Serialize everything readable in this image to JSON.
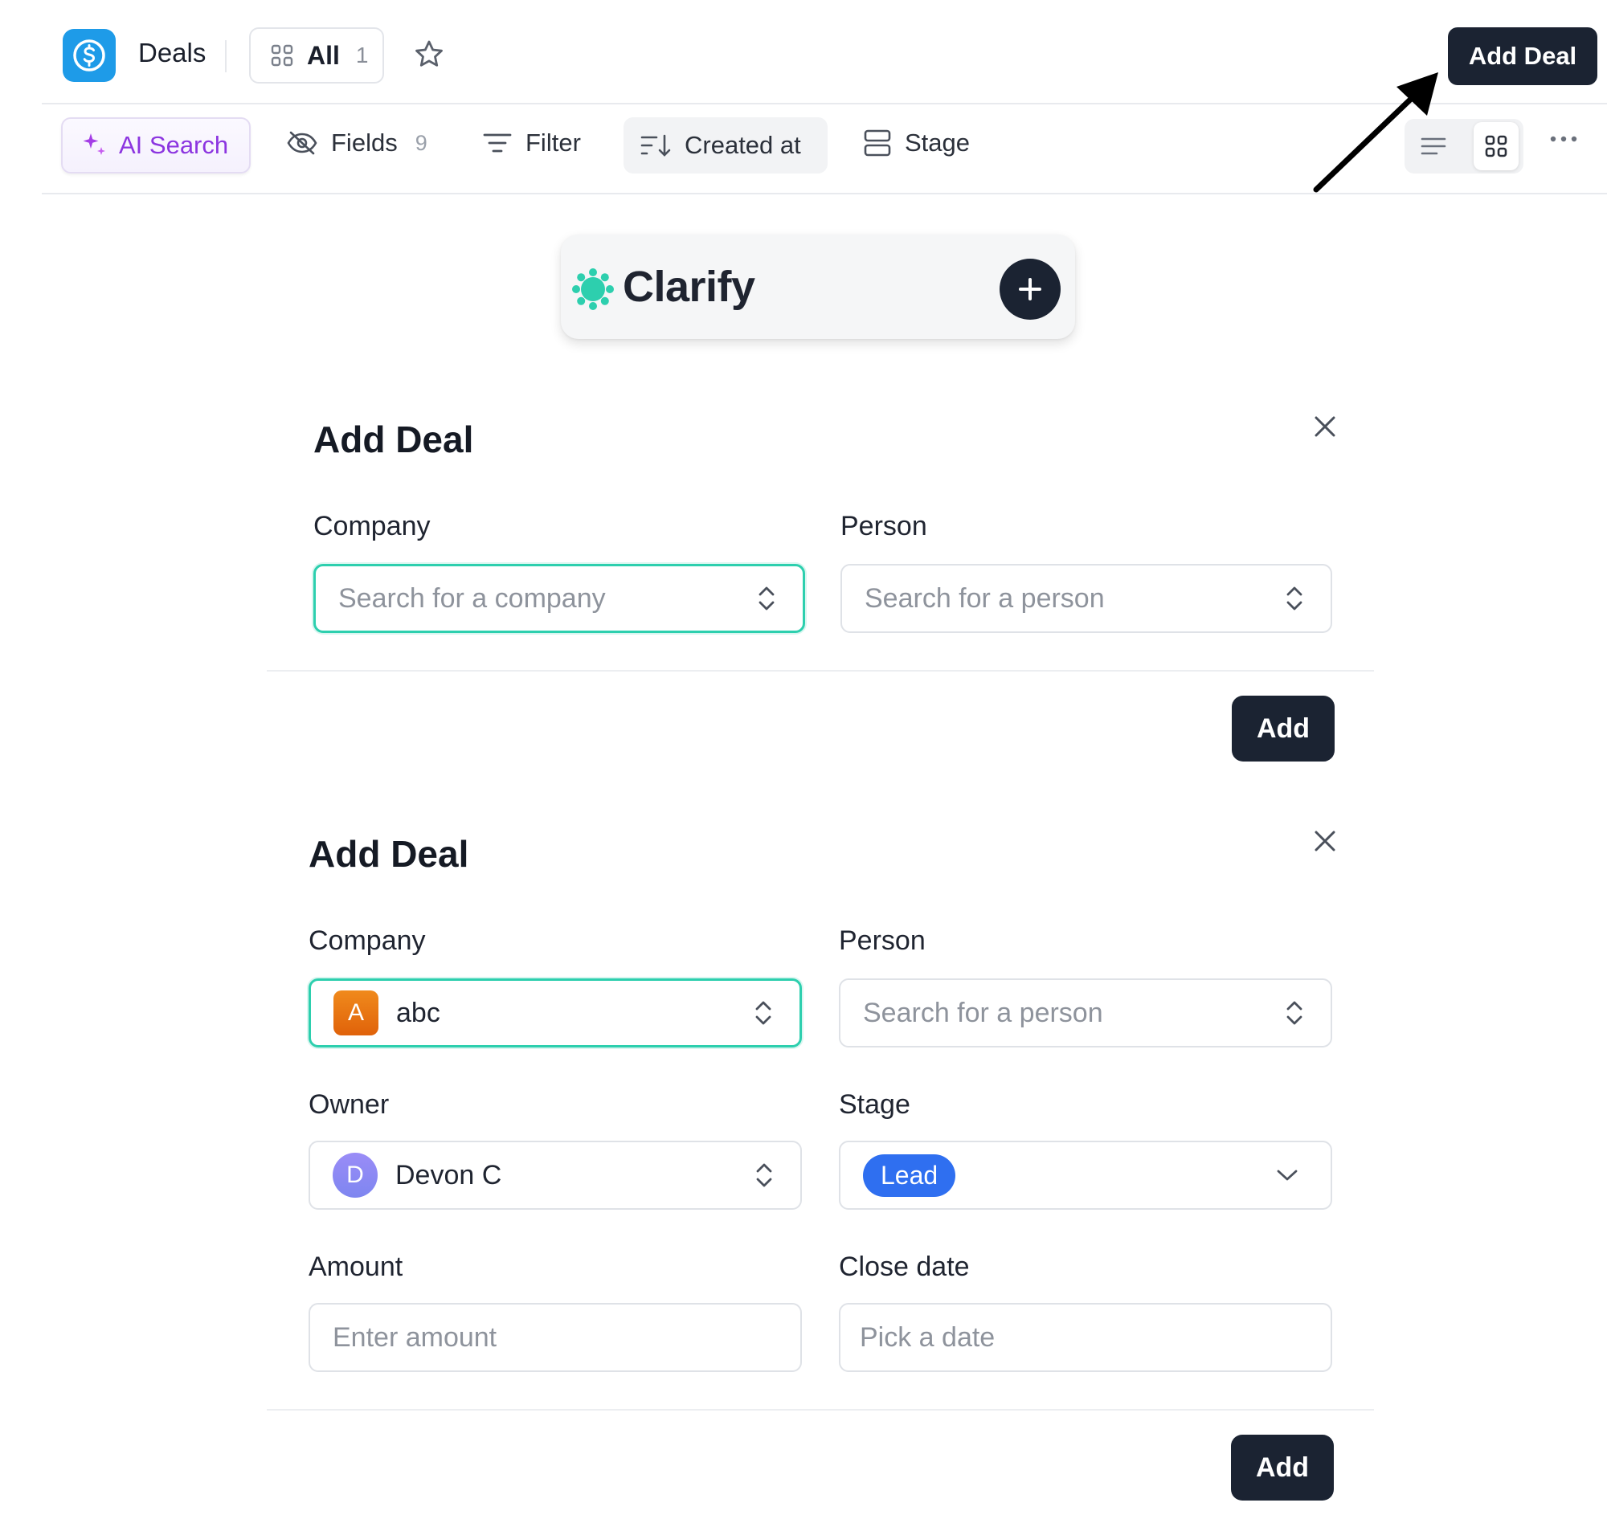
{
  "header": {
    "title": "Deals",
    "view_label": "All",
    "view_count": "1",
    "add_deal_label": "Add Deal",
    "brand_color": "#1e9be8"
  },
  "toolbar": {
    "ai_search_label": "AI Search",
    "fields_label": "Fields",
    "fields_count": "9",
    "filter_label": "Filter",
    "sort_label": "Created at",
    "group_label": "Stage"
  },
  "clarify": {
    "name": "Clarify",
    "accent": "#2dcfae"
  },
  "dialog1": {
    "title": "Add Deal",
    "company_label": "Company",
    "company_placeholder": "Search for a company",
    "person_label": "Person",
    "person_placeholder": "Search for a person",
    "submit_label": "Add"
  },
  "dialog2": {
    "title": "Add Deal",
    "company_label": "Company",
    "company_avatar": "A",
    "company_value": "abc",
    "person_label": "Person",
    "person_placeholder": "Search for a person",
    "owner_label": "Owner",
    "owner_avatar": "D",
    "owner_value": "Devon C",
    "stage_label": "Stage",
    "stage_value": "Lead",
    "amount_label": "Amount",
    "amount_placeholder": "Enter amount",
    "close_date_label": "Close date",
    "close_date_placeholder": "Pick a date",
    "submit_label": "Add"
  }
}
